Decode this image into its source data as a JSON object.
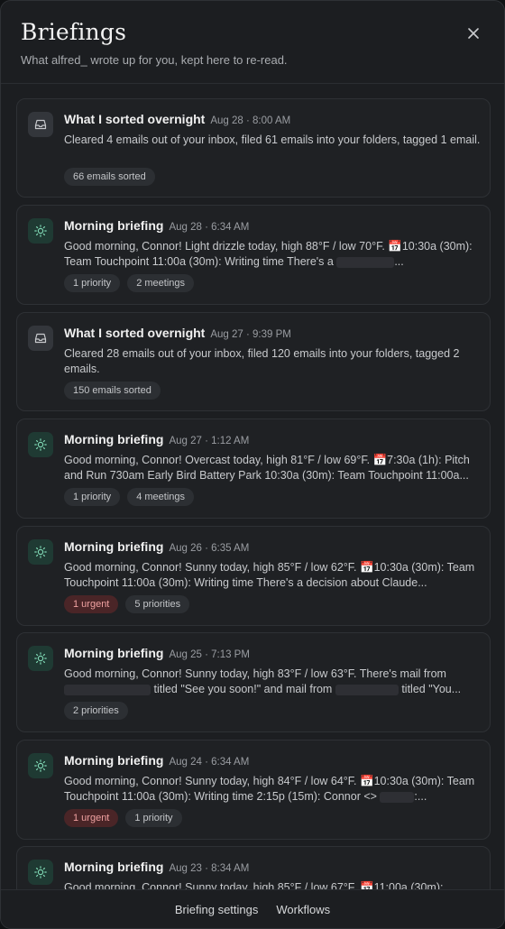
{
  "header": {
    "title": "Briefings",
    "subtitle": "What alfred_ wrote up for you, kept here to re-read."
  },
  "briefings": [
    {
      "icon": "inbox-tray-icon",
      "title": "What I sorted overnight",
      "time": "Aug 28 · 8:00 AM",
      "body": "Cleared 4 emails out of your inbox, filed 61 emails into your folders, tagged 1 email.",
      "tags": [
        {
          "label": "66 emails sorted",
          "urgent": false
        }
      ]
    },
    {
      "icon": "sun-icon",
      "title": "Morning briefing",
      "time": "Aug 28 · 6:34 AM",
      "body_parts": [
        "Good morning, Connor! Light drizzle today, high 88°F / low 70°F. 📅10:30a (30m): Team Touchpoint 11:00a (30m): Writing time There's a",
        "..."
      ],
      "tags": [
        {
          "label": "1 priority",
          "urgent": false
        },
        {
          "label": "2 meetings",
          "urgent": false
        }
      ]
    },
    {
      "icon": "inbox-tray-icon",
      "title": "What I sorted overnight",
      "time": "Aug 27 · 9:39 PM",
      "body": "Cleared 28 emails out of your inbox, filed 120 emails into your folders, tagged 2 emails.",
      "tags": [
        {
          "label": "150 emails sorted",
          "urgent": false
        }
      ]
    },
    {
      "icon": "sun-icon",
      "title": "Morning briefing",
      "time": "Aug 27 · 1:12 AM",
      "body": "Good morning, Connor! Overcast today, high 81°F / low 69°F. 📅7:30a (1h): Pitch and Run 730am Early Bird Battery Park 10:30a (30m): Team Touchpoint 11:00a...",
      "tags": [
        {
          "label": "1 priority",
          "urgent": false
        },
        {
          "label": "4 meetings",
          "urgent": false
        }
      ]
    },
    {
      "icon": "sun-icon",
      "title": "Morning briefing",
      "time": "Aug 26 · 6:35 AM",
      "body": "Good morning, Connor! Sunny today, high 85°F / low 62°F. 📅10:30a (30m): Team Touchpoint 11:00a (30m): Writing time There's a decision about Claude...",
      "tags": [
        {
          "label": "1 urgent",
          "urgent": true
        },
        {
          "label": "5 priorities",
          "urgent": false
        }
      ]
    },
    {
      "icon": "sun-icon",
      "title": "Morning briefing",
      "time": "Aug 25 · 7:13 PM",
      "body_parts": [
        "Good morning, Connor! Sunny today, high 83°F / low 63°F. There's mail from",
        "titled \"See you soon!\" and mail from",
        "titled \"You..."
      ],
      "tags": [
        {
          "label": "2 priorities",
          "urgent": false
        }
      ]
    },
    {
      "icon": "sun-icon",
      "title": "Morning briefing",
      "time": "Aug 24 · 6:34 AM",
      "body_parts": [
        "Good morning, Connor! Sunny today, high 84°F / low 64°F. 📅10:30a (30m): Team Touchpoint 11:00a (30m): Writing time 2:15p (15m): Connor <>",
        ":..."
      ],
      "tags": [
        {
          "label": "1 urgent",
          "urgent": true
        },
        {
          "label": "1 priority",
          "urgent": false
        }
      ]
    },
    {
      "icon": "sun-icon",
      "title": "Morning briefing",
      "time": "Aug 23 · 8:34 AM",
      "body": "Good morning, Connor! Sunny today, high 85°F / low 67°F. 📅11:00a (30m):",
      "tags": []
    }
  ],
  "footer": {
    "settings_label": "Briefing settings",
    "workflows_label": "Workflows"
  }
}
